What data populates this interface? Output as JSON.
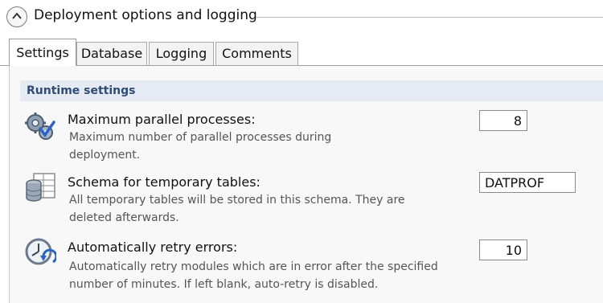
{
  "section": {
    "title": "Deployment options and logging"
  },
  "tabs": [
    {
      "label": "Settings",
      "active": true
    },
    {
      "label": "Database",
      "active": false
    },
    {
      "label": "Logging",
      "active": false
    },
    {
      "label": "Comments",
      "active": false
    }
  ],
  "runtime": {
    "header": "Runtime settings",
    "settings": [
      {
        "icon": "gears-check-icon",
        "title": "Maximum parallel processes:",
        "description": "Maximum number of parallel processes during deployment.",
        "value": "8"
      },
      {
        "icon": "database-table-icon",
        "title": "Schema for temporary tables:",
        "description": "All temporary tables will be stored in this schema. They are deleted afterwards.",
        "value": "DATPROF"
      },
      {
        "icon": "clock-retry-icon",
        "title": "Automatically retry errors:",
        "description": "Automatically retry modules which are in error after the specified number of minutes. If left blank, auto-retry is disabled.",
        "value": "10"
      }
    ]
  }
}
